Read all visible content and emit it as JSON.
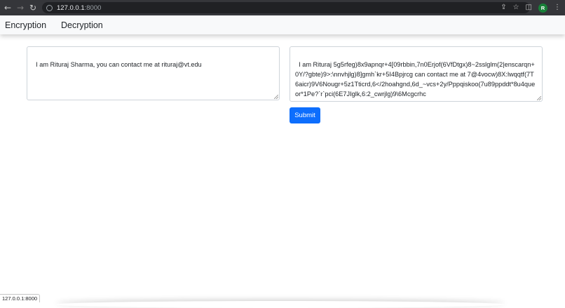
{
  "browser": {
    "url_host": "127.0.0.1",
    "url_port": ":8000",
    "profile_initial": "R"
  },
  "nav": {
    "encryption": "Encryption",
    "decryption": "Decryption"
  },
  "form": {
    "plaintext": "I am Rituraj Sharma, you can contact me at rituraj@vt.edu",
    "ciphertext": "I am Rituraj 5g5rfeg)8x9apnqr+4[09rbbin,7n0Erjof(6VfDtgx)8~2sslglm(2|enscarqn+0Y/?gbte)9>:\\nnvhjlg)8]gmh`kr+5I4Bpjrcg can contact me at 7@4vocw)8X:lwqqtf(7T6aicr)9V6Nougr+5z1Tticrd,6</2hoahgnd,6d_~vcs+2y/Pppqiskoo(7u89ppddt*8u4queor*1Pe?`r`pci(6E7JIglk,6:2_cwrjlg)9\\6Mcgcrhc",
    "submit_label": "Submit"
  },
  "status_bar": {
    "text": "127.0.0.1:8000"
  },
  "colors": {
    "chrome": "#35363a",
    "navbar": "#f8f9fa",
    "primary": "#0d6efd"
  }
}
